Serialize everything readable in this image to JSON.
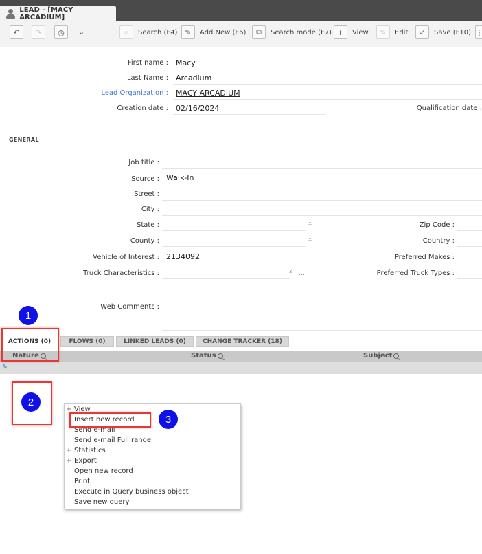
{
  "window": {
    "title": "LEAD - [MACY ARCADIUM]"
  },
  "toolbar": {
    "search": "Search (F4)",
    "add_new": "Add New (F6)",
    "search_mode": "Search mode (F7)",
    "view": "View",
    "edit": "Edit",
    "save": "Save (F10)"
  },
  "header_fields": {
    "first_name": {
      "label": "First name :",
      "value": "Macy"
    },
    "last_name": {
      "label": "Last Name :",
      "value": "Arcadium"
    },
    "lead_org": {
      "label": "Lead Organization :",
      "value": "MACY ARCADIUM"
    },
    "creation_date": {
      "label": "Creation date :",
      "value": "02/16/2024"
    },
    "qualification_date": {
      "label": "Qualification date :"
    }
  },
  "general": {
    "title": "GENERAL",
    "job_title": "Job title :",
    "source": {
      "label": "Source :",
      "value": "Walk-In"
    },
    "street": "Street :",
    "city": "City :",
    "state": "State :",
    "zip": "Zip Code :",
    "county": "County :",
    "country": "Country :",
    "vehicle": {
      "label": "Vehicle of Interest :",
      "value": "2134092"
    },
    "preferred_makes": "Preferred Makes :",
    "truck_char": "Truck Characteristics :",
    "preferred_truck_types": "Preferred Truck Types :",
    "web_comments": "Web Comments :"
  },
  "tabs": [
    "ACTIONS (0)",
    "FLOWS (0)",
    "LINKED LEADS (0)",
    "CHANGE TRACKER (18)"
  ],
  "grid": {
    "columns": [
      "Nature",
      "Status",
      "Subject"
    ]
  },
  "context_menu": [
    {
      "label": "View",
      "expandable": true
    },
    {
      "label": "Insert new record",
      "expandable": false
    },
    {
      "label": "Send e-mail",
      "expandable": false
    },
    {
      "label": "Send e-mail Full range",
      "expandable": false
    },
    {
      "label": "Statistics",
      "expandable": true
    },
    {
      "label": "Export",
      "expandable": true
    },
    {
      "label": "Open new record",
      "expandable": false
    },
    {
      "label": "Print",
      "expandable": false
    },
    {
      "label": "Execute in Query business object",
      "expandable": false
    },
    {
      "label": "Save new query",
      "expandable": false
    }
  ],
  "annotations": [
    "1",
    "2",
    "3"
  ]
}
